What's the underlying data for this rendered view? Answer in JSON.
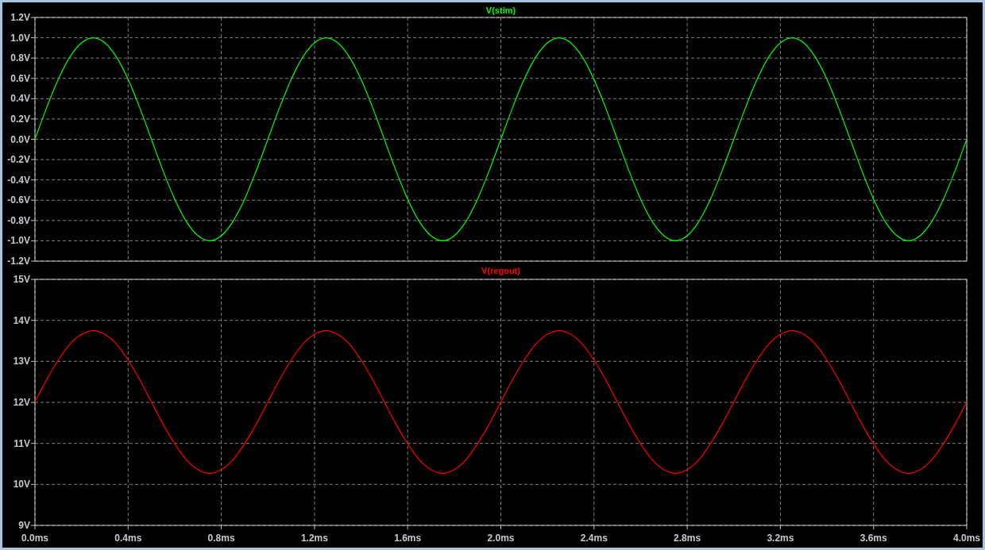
{
  "charts": [
    {
      "chart_data": {
        "type": "line",
        "grid": true,
        "xlim": [
          0,
          4
        ],
        "ylim": [
          -1.2,
          1.2
        ],
        "yticks": [
          {
            "value": 1.2,
            "label": "1.2V"
          },
          {
            "value": 1.0,
            "label": "1.0V"
          },
          {
            "value": 0.8,
            "label": "0.8V"
          },
          {
            "value": 0.6,
            "label": "0.6V"
          },
          {
            "value": 0.4,
            "label": "0.4V"
          },
          {
            "value": 0.2,
            "label": "0.2V"
          },
          {
            "value": 0.0,
            "label": "0.0V"
          },
          {
            "value": -0.2,
            "label": "-0.2V"
          },
          {
            "value": -0.4,
            "label": "-0.4V"
          },
          {
            "value": -0.6,
            "label": "-0.6V"
          },
          {
            "value": -0.8,
            "label": "-0.8V"
          },
          {
            "value": -1.0,
            "label": "-1.0V"
          },
          {
            "value": -1.2,
            "label": "-1.2V"
          }
        ],
        "x": [
          0,
          0.05,
          0.1,
          0.15,
          0.2,
          0.25,
          0.3,
          0.35,
          0.4,
          0.45,
          0.5,
          0.55,
          0.6,
          0.65,
          0.7,
          0.75,
          0.8,
          0.85,
          0.9,
          0.95,
          1,
          1.05,
          1.1,
          1.15,
          1.2,
          1.25,
          1.3,
          1.35,
          1.4,
          1.45,
          1.5,
          1.55,
          1.6,
          1.65,
          1.7,
          1.75,
          1.8,
          1.85,
          1.9,
          1.95,
          2,
          2.05,
          2.1,
          2.15,
          2.2,
          2.25,
          2.3,
          2.35,
          2.4,
          2.45,
          2.5,
          2.55,
          2.6,
          2.65,
          2.7,
          2.75,
          2.8,
          2.85,
          2.9,
          2.95,
          3,
          3.05,
          3.1,
          3.15,
          3.2,
          3.25,
          3.3,
          3.35,
          3.4,
          3.45,
          3.5,
          3.55,
          3.6,
          3.65,
          3.7,
          3.75,
          3.8,
          3.85,
          3.9,
          3.95,
          4
        ],
        "series": [
          {
            "name": "V(stim)",
            "color": "#00ff00",
            "values": [
              0,
              0.31,
              0.59,
              0.81,
              0.95,
              1,
              0.95,
              0.81,
              0.59,
              0.31,
              0,
              -0.31,
              -0.59,
              -0.81,
              -0.95,
              -1,
              -0.95,
              -0.81,
              -0.59,
              -0.31,
              0,
              0.31,
              0.59,
              0.81,
              0.95,
              1,
              0.95,
              0.81,
              0.59,
              0.31,
              0,
              -0.31,
              -0.59,
              -0.81,
              -0.95,
              -1,
              -0.95,
              -0.81,
              -0.59,
              -0.31,
              0,
              0.31,
              0.59,
              0.81,
              0.95,
              1,
              0.95,
              0.81,
              0.59,
              0.31,
              0,
              -0.31,
              -0.59,
              -0.81,
              -0.95,
              -1,
              -0.95,
              -0.81,
              -0.59,
              -0.31,
              0,
              0.31,
              0.59,
              0.81,
              0.95,
              1,
              0.95,
              0.81,
              0.59,
              0.31,
              0,
              -0.31,
              -0.59,
              -0.81,
              -0.95,
              -1,
              -0.95,
              -0.81,
              -0.59,
              -0.31,
              0
            ]
          }
        ]
      }
    },
    {
      "chart_data": {
        "type": "line",
        "grid": true,
        "xlim": [
          0,
          4
        ],
        "ylim": [
          9,
          15
        ],
        "xticks": [
          {
            "value": 0,
            "label": "0.0ms"
          },
          {
            "value": 0.4,
            "label": "0.4ms"
          },
          {
            "value": 0.8,
            "label": "0.8ms"
          },
          {
            "value": 1.2,
            "label": "1.2ms"
          },
          {
            "value": 1.6,
            "label": "1.6ms"
          },
          {
            "value": 2.0,
            "label": "2.0ms"
          },
          {
            "value": 2.4,
            "label": "2.4ms"
          },
          {
            "value": 2.8,
            "label": "2.8ms"
          },
          {
            "value": 3.2,
            "label": "3.2ms"
          },
          {
            "value": 3.6,
            "label": "3.6ms"
          },
          {
            "value": 4.0,
            "label": "4.0ms"
          }
        ],
        "yticks": [
          {
            "value": 15,
            "label": "15V"
          },
          {
            "value": 14,
            "label": "14V"
          },
          {
            "value": 13,
            "label": "13V"
          },
          {
            "value": 12,
            "label": "12V"
          },
          {
            "value": 11,
            "label": "11V"
          },
          {
            "value": 10,
            "label": "10V"
          },
          {
            "value": 9,
            "label": "9V"
          }
        ],
        "x": [
          0,
          0.05,
          0.1,
          0.15,
          0.2,
          0.25,
          0.3,
          0.35,
          0.4,
          0.45,
          0.5,
          0.55,
          0.6,
          0.65,
          0.7,
          0.75,
          0.8,
          0.85,
          0.9,
          0.95,
          1,
          1.05,
          1.1,
          1.15,
          1.2,
          1.25,
          1.3,
          1.35,
          1.4,
          1.45,
          1.5,
          1.55,
          1.6,
          1.65,
          1.7,
          1.75,
          1.8,
          1.85,
          1.9,
          1.95,
          2,
          2.05,
          2.1,
          2.15,
          2.2,
          2.25,
          2.3,
          2.35,
          2.4,
          2.45,
          2.5,
          2.55,
          2.6,
          2.65,
          2.7,
          2.75,
          2.8,
          2.85,
          2.9,
          2.95,
          3,
          3.05,
          3.1,
          3.15,
          3.2,
          3.25,
          3.3,
          3.35,
          3.4,
          3.45,
          3.5,
          3.55,
          3.6,
          3.65,
          3.7,
          3.75,
          3.8,
          3.85,
          3.9,
          3.95,
          4
        ],
        "series": [
          {
            "name": "V(regout)",
            "color": "#ff0000",
            "values": [
              12.01,
              12.55,
              13.03,
              13.42,
              13.66,
              13.75,
              13.66,
              13.42,
              13.03,
              12.55,
              12.01,
              11.47,
              10.99,
              10.6,
              10.36,
              10.27,
              10.36,
              10.6,
              10.99,
              11.47,
              12.01,
              12.55,
              13.03,
              13.42,
              13.66,
              13.75,
              13.66,
              13.42,
              13.03,
              12.55,
              12.01,
              11.47,
              10.99,
              10.6,
              10.36,
              10.27,
              10.36,
              10.6,
              10.99,
              11.47,
              12.01,
              12.55,
              13.03,
              13.42,
              13.66,
              13.75,
              13.66,
              13.42,
              13.03,
              12.55,
              12.01,
              11.47,
              10.99,
              10.6,
              10.36,
              10.27,
              10.36,
              10.6,
              10.99,
              11.47,
              12.01,
              12.55,
              13.03,
              13.42,
              13.66,
              13.75,
              13.66,
              13.42,
              13.03,
              12.55,
              12.01,
              11.47,
              10.99,
              10.6,
              10.36,
              10.27,
              10.36,
              10.6,
              10.99,
              11.47,
              12.01
            ]
          }
        ]
      }
    }
  ]
}
